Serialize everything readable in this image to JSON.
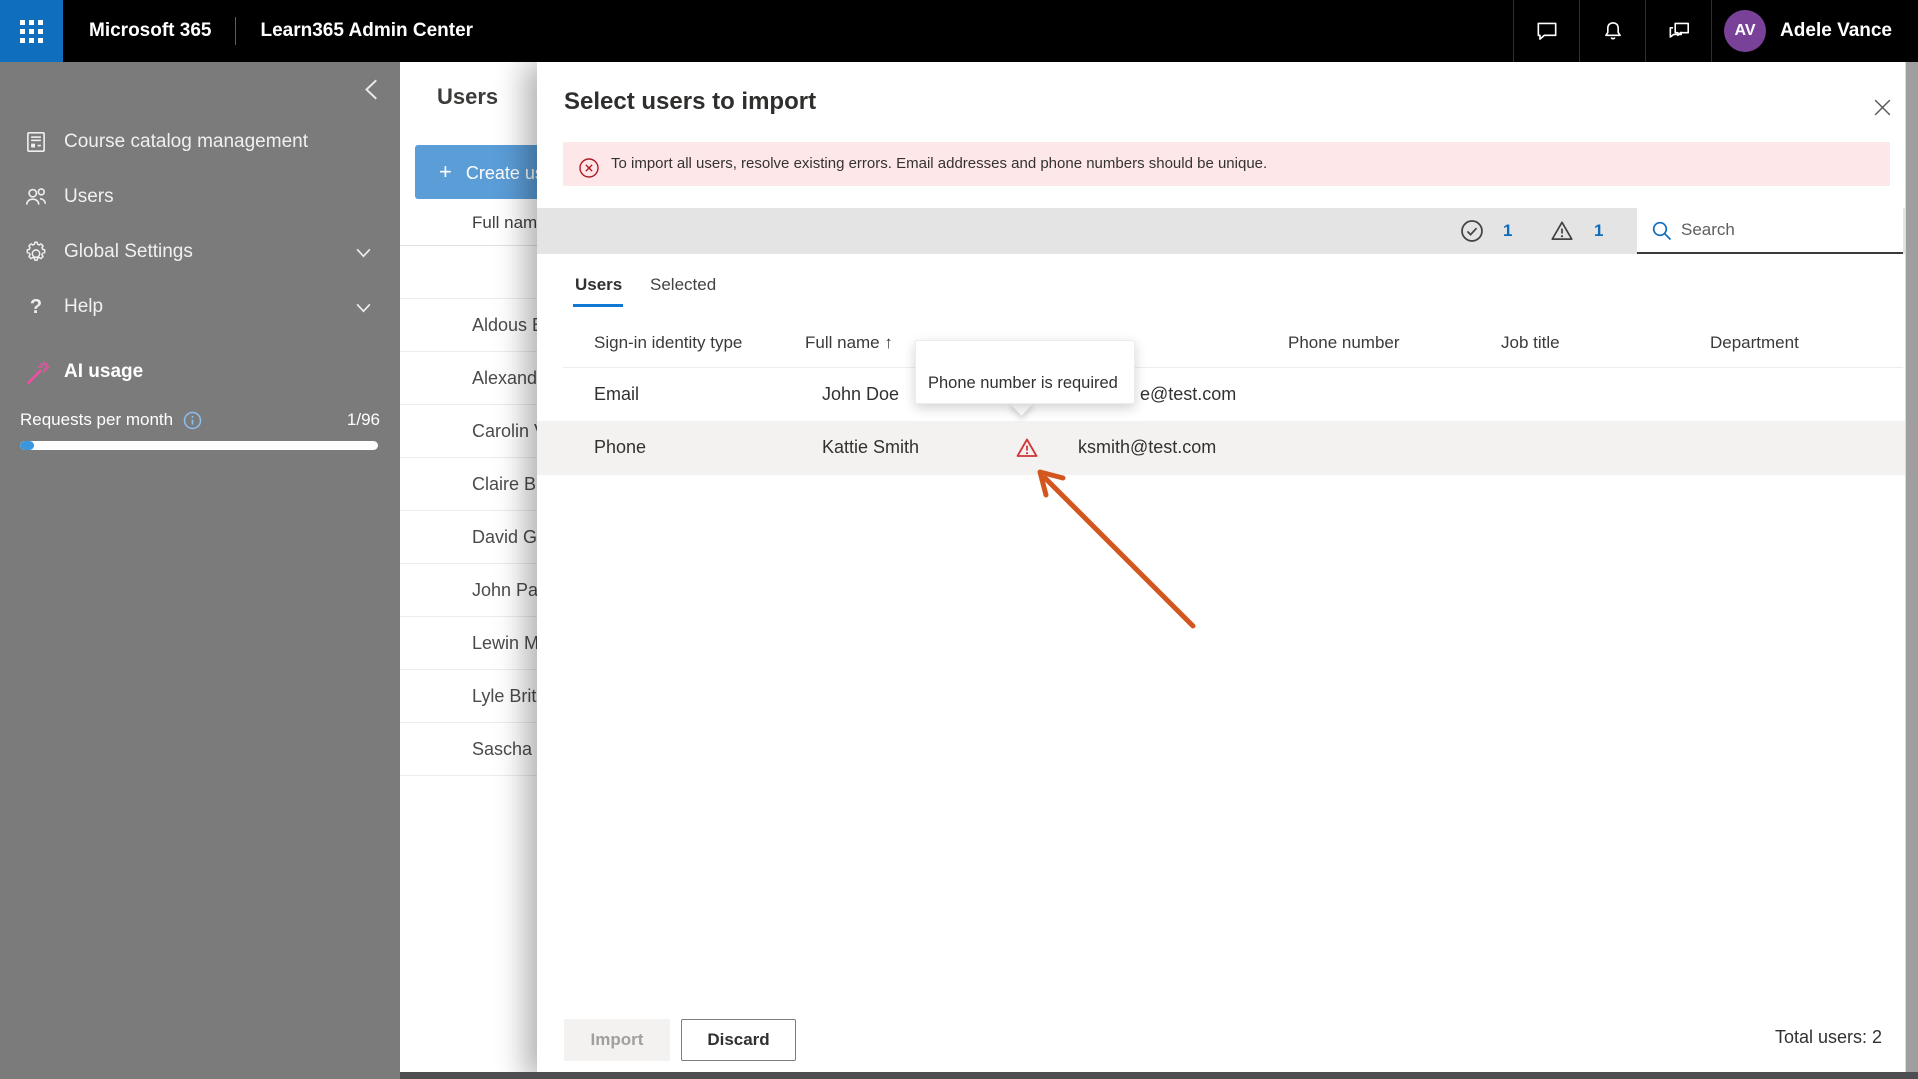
{
  "colors": {
    "accent_blue": "#0f6cbd",
    "error_red": "#d13438",
    "banner_bg": "#fde7e9",
    "arrow_orange": "#d4561f",
    "avatar_purple": "#7a4199",
    "create_button_blue": "#5b9dd7",
    "sidebar_gray": "#7b7b7b",
    "ai_wand_pink": "#e3008c"
  },
  "topbar": {
    "product": "Microsoft 365",
    "app": "Learn365 Admin Center",
    "user_initials": "AV",
    "user_name": "Adele Vance"
  },
  "sidebar": {
    "items": [
      {
        "label": "Course catalog management"
      },
      {
        "label": "Users"
      },
      {
        "label": "Global Settings"
      },
      {
        "label": "Help"
      }
    ],
    "ai_label": "AI usage",
    "requests_label": "Requests per month",
    "requests_value": "1/96"
  },
  "page": {
    "title": "Users",
    "create_label": "Create us",
    "column_fullname": "Full nam",
    "rows": [
      "Aldous E",
      "Alexand",
      "Carolin V",
      "Claire Br",
      "David G",
      "John Pau",
      "Lewin M",
      "Lyle Brit",
      "Sascha N"
    ]
  },
  "modal": {
    "title": "Select users to import",
    "banner_text": "To import all users, resolve existing errors. Email addresses and phone numbers should be unique.",
    "success_count": "1",
    "warning_count": "1",
    "search_placeholder": "Search",
    "tab_users": "Users",
    "tab_selected": "Selected",
    "columns": {
      "type": "Sign-in identity type",
      "fullname": "Full name",
      "sort_arrow": "↑",
      "phone": "Phone number",
      "job": "Job title",
      "department": "Department"
    },
    "rows": [
      {
        "type": "Email",
        "name": "John Doe",
        "email": "e@test.com"
      },
      {
        "type": "Phone",
        "name": "Kattie Smith",
        "email": "ksmith@test.com"
      }
    ],
    "tooltip": "Phone number is required",
    "import_label": "Import",
    "discard_label": "Discard",
    "total_label": "Total users: 2"
  }
}
